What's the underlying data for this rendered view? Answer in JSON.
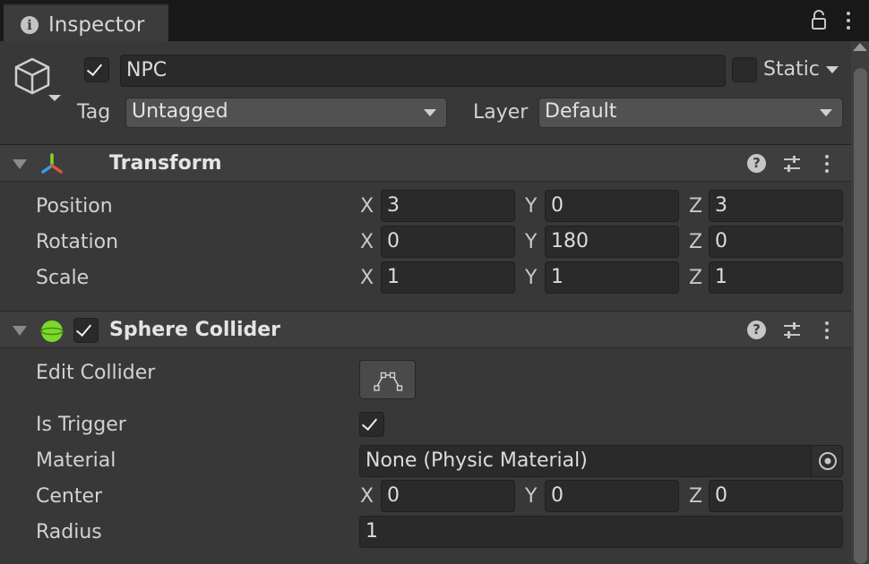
{
  "tab": {
    "title": "Inspector",
    "info_icon": "i"
  },
  "header": {
    "active": true,
    "name": "NPC",
    "static_label": "Static",
    "static_checked": false,
    "tag_label": "Tag",
    "tag_value": "Untagged",
    "layer_label": "Layer",
    "layer_value": "Default"
  },
  "transform": {
    "title": "Transform",
    "help": "?",
    "rows": [
      {
        "label": "Position",
        "x": "3",
        "y": "0",
        "z": "3"
      },
      {
        "label": "Rotation",
        "x": "0",
        "y": "180",
        "z": "0"
      },
      {
        "label": "Scale",
        "x": "1",
        "y": "1",
        "z": "1"
      }
    ],
    "axis_x": "X",
    "axis_y": "Y",
    "axis_z": "Z"
  },
  "sphere_collider": {
    "title": "Sphere Collider",
    "enabled": true,
    "help": "?",
    "edit_collider_label": "Edit Collider",
    "is_trigger_label": "Is Trigger",
    "is_trigger": true,
    "material_label": "Material",
    "material_value": "None (Physic Material)",
    "center_label": "Center",
    "center": {
      "x": "0",
      "y": "0",
      "z": "0"
    },
    "radius_label": "Radius",
    "radius_value": "1"
  },
  "colors": {
    "background": "#383838",
    "field": "#2a2a2a",
    "header": "#3e3e3e",
    "collider_icon": "#7cd92c"
  }
}
